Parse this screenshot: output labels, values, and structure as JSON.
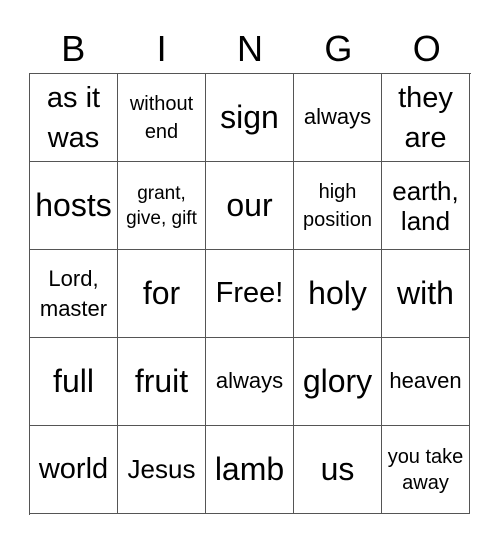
{
  "header": [
    "B",
    "I",
    "N",
    "G",
    "O"
  ],
  "cells": [
    [
      "as it was",
      "without end",
      "sign",
      "always",
      "they are"
    ],
    [
      "hosts",
      "grant, give, gift",
      "our",
      "high position",
      "earth, land"
    ],
    [
      "Lord, master",
      "for",
      "Free!",
      "holy",
      "with"
    ],
    [
      "full",
      "fruit",
      "always",
      "glory",
      "heaven"
    ],
    [
      "world",
      "Jesus",
      "lamb",
      "us",
      "you take away"
    ]
  ]
}
